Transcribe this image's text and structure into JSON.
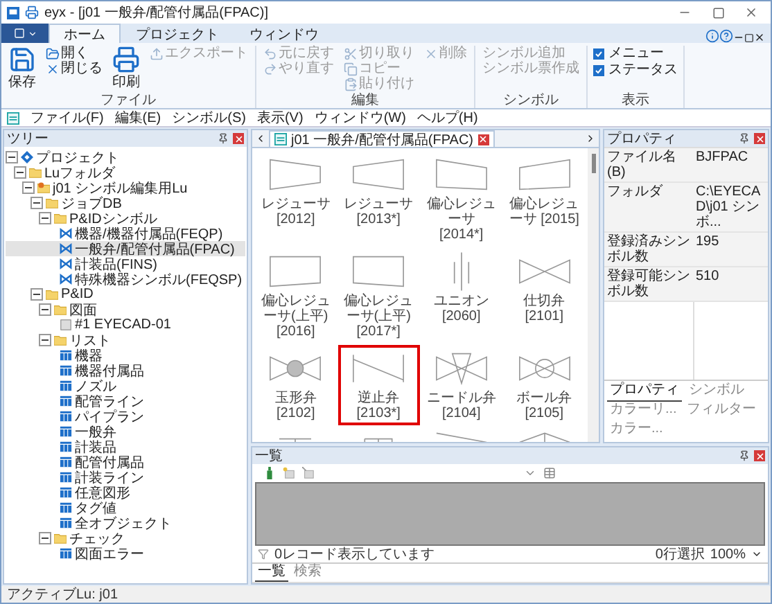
{
  "window": {
    "title": "eyx - [j01 一般弁/配管付属品(FPAC)]"
  },
  "ribbon_tabs": [
    {
      "label": "ホーム",
      "selected": true
    },
    {
      "label": "プロジェクト",
      "selected": false
    },
    {
      "label": "ウィンドウ",
      "selected": false
    }
  ],
  "ribbon_groups": [
    {
      "label": "ファイル",
      "columns": [
        [
          {
            "kind": "large",
            "label": "保存",
            "disabled": false
          }
        ],
        [
          {
            "kind": "small",
            "label": "開く",
            "disabled": false
          },
          {
            "kind": "small",
            "label": "閉じる",
            "disabled": false
          }
        ],
        [
          {
            "kind": "large",
            "label": "印刷",
            "disabled": false
          }
        ],
        [
          {
            "kind": "small",
            "label": "エクスポート",
            "disabled": true
          }
        ]
      ]
    },
    {
      "label": "編集",
      "columns": [
        [
          {
            "kind": "small",
            "label": "元に戻す",
            "disabled": true
          },
          {
            "kind": "small",
            "label": "やり直す",
            "disabled": true
          }
        ],
        [
          {
            "kind": "small",
            "label": "切り取り",
            "disabled": true
          },
          {
            "kind": "small",
            "label": "コピー",
            "disabled": true
          },
          {
            "kind": "small",
            "label": "貼り付け",
            "disabled": true
          }
        ],
        [
          {
            "kind": "small",
            "label": "削除",
            "disabled": true
          }
        ]
      ]
    },
    {
      "label": "シンボル",
      "columns": [
        [
          {
            "kind": "text",
            "label": "シンボル追加",
            "disabled": true
          },
          {
            "kind": "text",
            "label": "シンボル票作成",
            "disabled": true
          }
        ]
      ]
    },
    {
      "label": "表示",
      "columns": [
        [
          {
            "kind": "check",
            "label": "メニュー",
            "checked": true
          },
          {
            "kind": "check",
            "label": "ステータス",
            "checked": true
          }
        ]
      ]
    }
  ],
  "menu": [
    "ファイル(F)",
    "編集(E)",
    "シンボル(S)",
    "表示(V)",
    "ウィンドウ(W)",
    "ヘルプ(H)"
  ],
  "tree": {
    "title": "ツリー",
    "items": [
      {
        "label": "プロジェクト",
        "kind": "root",
        "expanded": true,
        "selected": false,
        "children": [
          {
            "label": "Luフォルダ",
            "kind": "folder",
            "expanded": true,
            "selected": false,
            "children": [
              {
                "label": "j01 シンボル編集用Lu",
                "kind": "lu",
                "expanded": true,
                "selected": false,
                "children": [
                  {
                    "label": "ジョブDB",
                    "kind": "folder",
                    "expanded": true,
                    "selected": false,
                    "children": [
                      {
                        "label": "P&IDシンボル",
                        "kind": "folder",
                        "expanded": true,
                        "selected": false,
                        "children": [
                          {
                            "label": "機器/機器付属品(FEQP)",
                            "kind": "symbol",
                            "selected": false
                          },
                          {
                            "label": "一般弁/配管付属品(FPAC)",
                            "kind": "symbol",
                            "selected": true
                          },
                          {
                            "label": "計装品(FINS)",
                            "kind": "symbol",
                            "selected": false
                          },
                          {
                            "label": "特殊機器シンボル(FEQSP)",
                            "kind": "symbol",
                            "selected": false
                          }
                        ]
                      }
                    ]
                  },
                  {
                    "label": "P&ID",
                    "kind": "folder",
                    "expanded": true,
                    "selected": false,
                    "children": [
                      {
                        "label": "図面",
                        "kind": "folder",
                        "expanded": true,
                        "selected": false,
                        "children": [
                          {
                            "label": "#1 EYECAD-01",
                            "kind": "drawing",
                            "selected": false
                          }
                        ]
                      },
                      {
                        "label": "リスト",
                        "kind": "folder",
                        "expanded": true,
                        "selected": false,
                        "children": [
                          {
                            "label": "機器",
                            "kind": "list",
                            "selected": false
                          },
                          {
                            "label": "機器付属品",
                            "kind": "list",
                            "selected": false
                          },
                          {
                            "label": "ノズル",
                            "kind": "list",
                            "selected": false
                          },
                          {
                            "label": "配管ライン",
                            "kind": "list",
                            "selected": false
                          },
                          {
                            "label": "パイプラン",
                            "kind": "list",
                            "selected": false
                          },
                          {
                            "label": "一般弁",
                            "kind": "list",
                            "selected": false
                          },
                          {
                            "label": "計装品",
                            "kind": "list",
                            "selected": false
                          },
                          {
                            "label": "配管付属品",
                            "kind": "list",
                            "selected": false
                          },
                          {
                            "label": "計装ライン",
                            "kind": "list",
                            "selected": false
                          },
                          {
                            "label": "任意図形",
                            "kind": "list",
                            "selected": false
                          },
                          {
                            "label": "タグ値",
                            "kind": "list",
                            "selected": false
                          },
                          {
                            "label": "全オブジェクト",
                            "kind": "list",
                            "selected": false
                          }
                        ]
                      },
                      {
                        "label": "チェック",
                        "kind": "folder",
                        "expanded": true,
                        "selected": false,
                        "children": [
                          {
                            "label": "図面エラー",
                            "kind": "list",
                            "selected": false
                          }
                        ]
                      }
                    ]
                  }
                ]
              }
            ]
          }
        ]
      }
    ]
  },
  "document_tab": {
    "label": "j01 一般弁/配管付属品(FPAC)"
  },
  "symbols": [
    {
      "label": "レジューサ [2012]",
      "kind": "reducer_a",
      "selected": false
    },
    {
      "label": "レジューサ [2013*]",
      "kind": "reducer_b",
      "selected": false
    },
    {
      "label": "偏心レジューサ [2014*]",
      "kind": "ecc_a",
      "selected": false
    },
    {
      "label": "偏心レジューサ [2015]",
      "kind": "ecc_b",
      "selected": false
    },
    {
      "label": "偏心レジューサ(上平) [2016]",
      "kind": "flat_a",
      "selected": false
    },
    {
      "label": "偏心レジューサ(上平) [2017*]",
      "kind": "flat_b",
      "selected": false
    },
    {
      "label": "ユニオン [2060]",
      "kind": "union",
      "selected": false
    },
    {
      "label": "仕切弁 [2101]",
      "kind": "gate",
      "selected": false
    },
    {
      "label": "玉形弁 [2102]",
      "kind": "globe",
      "selected": false
    },
    {
      "label": "逆止弁 [2103*]",
      "kind": "check",
      "selected": true
    },
    {
      "label": "ニードル弁 [2104]",
      "kind": "needle",
      "selected": false
    },
    {
      "label": "ボール弁 [2105]",
      "kind": "ball",
      "selected": false
    },
    {
      "kind": "tee",
      "selected": false
    },
    {
      "kind": "grid",
      "selected": false
    },
    {
      "kind": "angle",
      "selected": false
    },
    {
      "kind": "diagonal",
      "selected": false
    }
  ],
  "properties": {
    "title": "プロパティ",
    "rows": [
      {
        "name": "ファイル名(B)",
        "value": "BJFPAC"
      },
      {
        "name": "フォルダ",
        "value": "C:\\EYECAD\\j01 シンボ..."
      },
      {
        "name": "登録済みシンボル数",
        "value": "195"
      },
      {
        "name": "登録可能シンボル数",
        "value": "510"
      }
    ],
    "tabs": [
      {
        "label": "プロパティ",
        "selected": true
      },
      {
        "label": "シンボル",
        "selected": false
      },
      {
        "label": "カラーリ...",
        "selected": false
      },
      {
        "label": "フィルター",
        "selected": false
      },
      {
        "label": "カラー...",
        "selected": false
      }
    ]
  },
  "list_panel": {
    "title": "一覧",
    "record_status": "0レコード表示しています",
    "selection": "0行選択",
    "zoom": "100%",
    "tabs": [
      {
        "label": "一覧",
        "selected": true
      },
      {
        "label": "検索",
        "selected": false
      }
    ]
  },
  "status_bar": "アクティブLu: j01"
}
